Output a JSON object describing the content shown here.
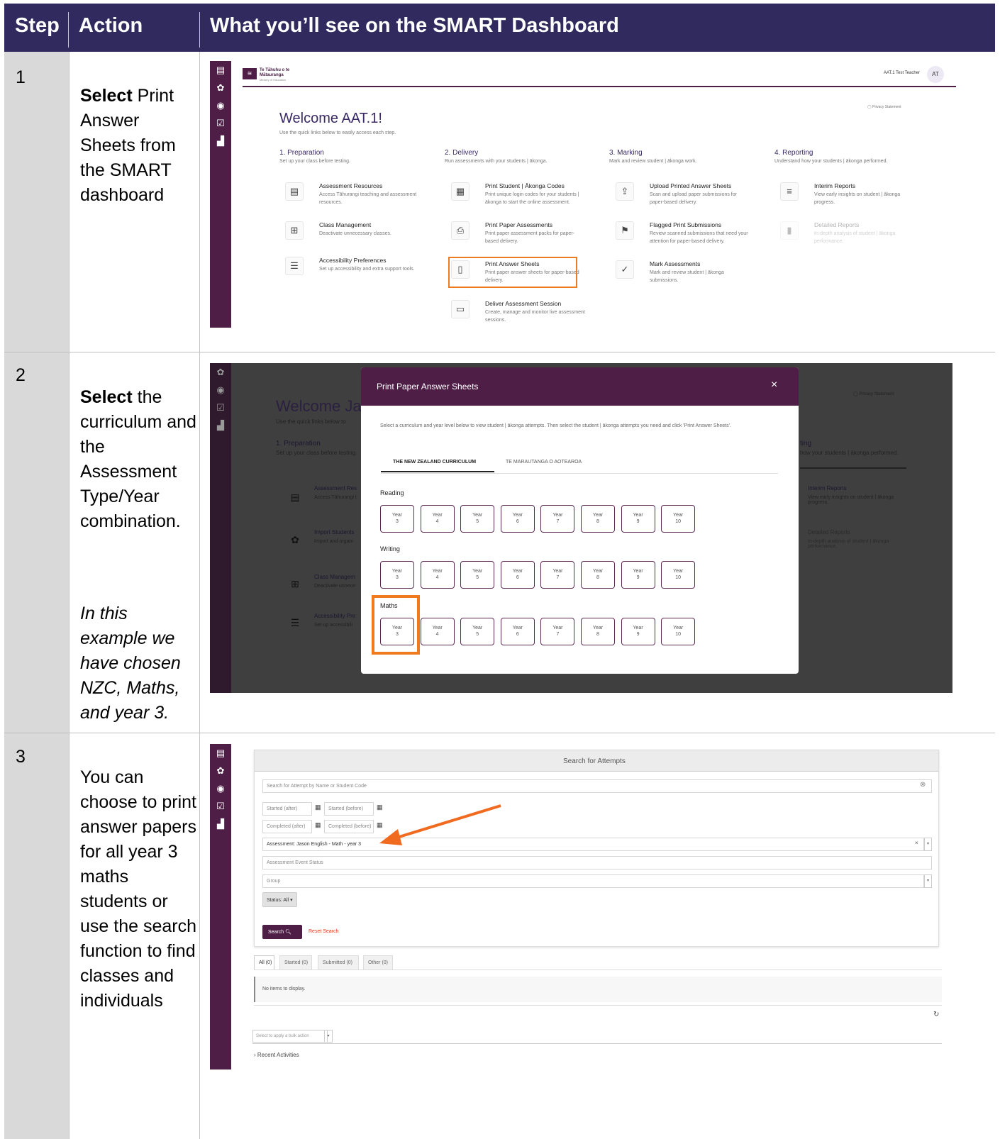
{
  "header": {
    "step": "Step",
    "action": "Action",
    "what": "What you’ll see on the SMART Dashboard"
  },
  "rows": [
    {
      "step": "1",
      "action_bold": "Select",
      "action_text": " Print Answer Sheets from the SMART dashboard"
    },
    {
      "step": "2",
      "action_bold": "Select",
      "action_text": " the curriculum and the Assessment Type/Year combination.",
      "note": "In this example we have chosen NZC, Maths, and year 3."
    },
    {
      "step": "3",
      "action_text": "You can choose to print answer papers for all year 3 maths students or use the search function to find classes and individuals"
    }
  ],
  "screen1": {
    "logo_text": "Te Tāhuhu o te Mātauranga",
    "logo_sub": "Ministry of Education",
    "user_name": "AAT.1 Test Teacher",
    "user_initials": "AT",
    "privacy": "Privacy Statement",
    "welcome": "Welcome AAT.1!",
    "welcome_sub": "Use the quick links below to easily access each step.",
    "columns": [
      {
        "title": "1. Preparation",
        "sub": "Set up your class before testing.",
        "items": [
          {
            "icon": "book",
            "title": "Assessment Resources",
            "desc": "Access Tāhurangi teaching and assessment resources."
          },
          {
            "icon": "grid",
            "title": "Class Management",
            "desc": "Deactivate unnecessary classes."
          },
          {
            "icon": "sliders",
            "title": "Accessibility Preferences",
            "desc": "Set up accessibility and extra support tools."
          }
        ]
      },
      {
        "title": "2. Delivery",
        "sub": "Run assessments with your students | ākonga.",
        "items": [
          {
            "icon": "qr",
            "title": "Print Student | Ākonga Codes",
            "desc": "Print unique login codes for your students | ākonga to start the online assessment."
          },
          {
            "icon": "printer",
            "title": "Print Paper Assessments",
            "desc": "Print paper assessment packs for paper-based delivery."
          },
          {
            "icon": "doc",
            "title": "Print Answer Sheets",
            "desc": "Print paper answer sheets for paper-based delivery."
          },
          {
            "icon": "monitor",
            "title": "Deliver Assessment Session",
            "desc": "Create, manage and monitor live assessment sessions."
          }
        ]
      },
      {
        "title": "3. Marking",
        "sub": "Mark and review student | ākonga work.",
        "items": [
          {
            "icon": "upload",
            "title": "Upload Printed Answer Sheets",
            "desc": "Scan and upload paper submissions for paper-based delivery."
          },
          {
            "icon": "flag",
            "title": "Flagged Print Submissions",
            "desc": "Review scanned submissions that need your attention for paper-based delivery."
          },
          {
            "icon": "check",
            "title": "Mark Assessments",
            "desc": "Mark and review student | ākonga submissions."
          }
        ]
      },
      {
        "title": "4. Reporting",
        "sub": "Understand how your students | ākonga performed.",
        "items": [
          {
            "icon": "report",
            "title": "Interim Reports",
            "desc": "View early insights on student | ākonga progress."
          },
          {
            "icon": "chart",
            "title": "Detailed Reports",
            "desc": "In-depth analysis of student | ākonga performance."
          }
        ]
      }
    ]
  },
  "screen2": {
    "bg_welcome": "Welcome Ja",
    "bg_welcome_sub": "Use the quick links below to",
    "bg_prep": "1. Preparation",
    "bg_prep_sub": "Set up your class before testing.",
    "bg_rep": "ting",
    "bg_rep_sub": "how your students | ākonga performed.",
    "bg_privacy": "Privacy Statement",
    "bg_items_left": [
      {
        "title": "Assessment Res",
        "desc": "Access Tāhurangi t"
      },
      {
        "title": "Import Students",
        "desc": "Import and organi"
      },
      {
        "title": "Class Managem",
        "desc": "Deactivate unnece"
      },
      {
        "title": "Accessibility Pre",
        "desc": "Set up accessibili"
      }
    ],
    "bg_items_right": [
      {
        "title": "Interim Reports",
        "desc": "View early insights on student | ākonga progress."
      },
      {
        "title": "Detailed Reports",
        "desc": "In-depth analysis of student | ākonga performance."
      }
    ],
    "modal_title": "Print Paper Answer Sheets",
    "modal_close": "×",
    "modal_instr": "Select a curriculum and year level below to view student | ākonga attempts. Then select the student | ākonga attempts you need and click 'Print Answer Sheets'.",
    "tabs": [
      "THE NEW ZEALAND CURRICULUM",
      "TE MARAUTANGA O AOTEAROA"
    ],
    "subjects": [
      {
        "name": "Reading",
        "years": [
          "3",
          "4",
          "5",
          "6",
          "7",
          "8",
          "9",
          "10"
        ]
      },
      {
        "name": "Writing",
        "years": [
          "3",
          "4",
          "5",
          "6",
          "7",
          "8",
          "9",
          "10"
        ]
      },
      {
        "name": "Maths",
        "years": [
          "3",
          "4",
          "5",
          "6",
          "7",
          "8",
          "9",
          "10"
        ]
      }
    ],
    "year_label": "Year"
  },
  "screen3": {
    "panel_title": "Search for Attempts",
    "search_placeholder": "Search for Attempt by Name or Student Code",
    "started_after": "Started (after)",
    "started_before": "Started (before)",
    "completed_after": "Completed (after)",
    "completed_before": "Completed (before)",
    "assessment_value": "Assessment: Jason English - Math - year 3",
    "event_status": "Assessment Event Status",
    "group": "Group",
    "status_btn": "Status: All ▾",
    "search_btn": "Search",
    "reset": "Reset Search",
    "tabs": [
      "All (0)",
      "Started (0)",
      "Submitted (0)",
      "Other (0)"
    ],
    "no_items": "No items to display.",
    "bulk": "Select to apply a bulk action",
    "recent": "Recent Activities"
  },
  "colors": {
    "header_bg": "#302a5e",
    "sidebar": "#4e1e47",
    "highlight": "#f07b1f",
    "modal_header": "#4e1e47"
  }
}
